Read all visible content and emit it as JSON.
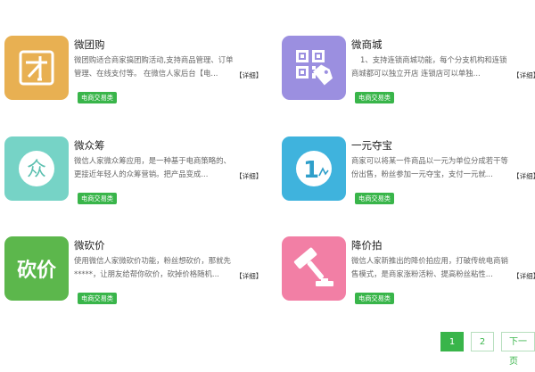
{
  "cards": [
    {
      "title": "微团购",
      "desc": "微团购适合商家搞团购活动,支持商品管理、订单管理、在线支付等。 在微信人家后台【电...",
      "detail": "【详细】",
      "badge": "电商交易类",
      "icon": "tuan-icon",
      "icon_glyph": "团",
      "color": "#e8b052"
    },
    {
      "title": "微商城",
      "desc": "1、支持连锁商城功能，每个分支机构和连锁商城都可以独立开店 连锁店可以单独...",
      "detail": "【详细】",
      "badge": "电商交易类",
      "icon": "qr-code-tag-icon",
      "color": "#9b8fe0"
    },
    {
      "title": "微众筹",
      "desc": "微信人家微众筹应用，是一种基于电商策略的、更接近年轻人的众筹营销。把产品变成...",
      "detail": "【详细】",
      "badge": "电商交易类",
      "icon": "zhong-icon",
      "icon_glyph": "众",
      "color": "#76d3c6"
    },
    {
      "title": "一元夺宝",
      "desc": "商家可以将某一件商品以一元为单位分成若干等份出售，粉丝参加一元夺宝，支付一元就...",
      "detail": "【详细】",
      "badge": "电商交易类",
      "icon": "one-yuan-icon",
      "icon_glyph": "1",
      "color": "#3fb3dd"
    },
    {
      "title": "微砍价",
      "desc": "使用微信人家微砍价功能，粉丝想砍价，那就先*****，让朋友给帮你砍价，砍掉价格随机...",
      "detail": "【详细】",
      "badge": "电商交易类",
      "icon": "kanjia-icon",
      "icon_glyph": "砍价",
      "color": "#5cb74c"
    },
    {
      "title": "降价拍",
      "desc": "微信人家新推出的降价拍应用，打破传统电商销售模式，是商家涨粉活粉、提高粉丝粘性...",
      "detail": "【详细】",
      "badge": "电商交易类",
      "icon": "auction-hammer-icon",
      "color": "#f27fa5"
    }
  ],
  "pager": {
    "page1": "1",
    "page2": "2",
    "next": "下一页",
    "active_color": "#39b54a"
  }
}
